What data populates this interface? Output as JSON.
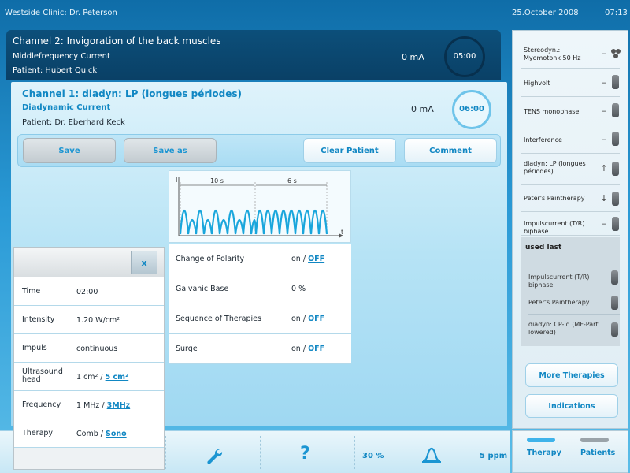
{
  "status_bar": {
    "clinic": "Westside Clinic: Dr. Peterson",
    "date": "25.October 2008",
    "time": "07:13"
  },
  "channel2": {
    "title": "Channel 2: Invigoration of the back muscles",
    "current_type": "Middlefrequency Current",
    "patient": "Patient: Hubert Quick",
    "intensity": "0 mA",
    "timer": "05:00"
  },
  "channel1": {
    "title": "Channel 1: diadyn: LP (longues périodes)",
    "current_type": "Diadynamic Current",
    "patient": "Patient: Dr. Eberhard Keck",
    "intensity": "0 mA",
    "timer": "06:00"
  },
  "buttons": {
    "save": "Save",
    "save_as": "Save as",
    "clear_patient": "Clear Patient",
    "comment": "Comment"
  },
  "waveform": {
    "axis_y": "I",
    "axis_x": "t",
    "segment1": "10 s",
    "segment2": "6 s"
  },
  "params": {
    "polarity": {
      "label": "Change of Polarity",
      "on": "on",
      "sep": " / ",
      "off": "OFF"
    },
    "galvanic": {
      "label": "Galvanic Base",
      "value": "0 %"
    },
    "sequence": {
      "label": "Sequence of Therapies",
      "on": "on",
      "sep": " / ",
      "off": "OFF"
    },
    "surge": {
      "label": "Surge",
      "on": "on",
      "sep": " / ",
      "off": "OFF"
    }
  },
  "popup": {
    "close": "x",
    "rows": {
      "time": {
        "label": "Time",
        "value": "02:00"
      },
      "intensity": {
        "label": "Intensity",
        "value": "1.20 W/cm²"
      },
      "impuls": {
        "label": "Impuls",
        "value": "continuous"
      },
      "head": {
        "label": "Ultrasound head",
        "opt1": "1 cm²",
        "sep": " / ",
        "opt2": "5 cm²"
      },
      "frequency": {
        "label": "Frequency",
        "opt1": "1 MHz",
        "sep": " / ",
        "opt2": "3MHz"
      },
      "therapy": {
        "label": "Therapy",
        "opt1": "Comb",
        "sep": " / ",
        "opt2": "Sono"
      }
    }
  },
  "bottom_bar": {
    "percent": "30 %",
    "ppm": "5 ppm",
    "help": "?"
  },
  "sidebar": {
    "items": [
      {
        "label": "Stereodyn.: Myomotonk 50 Hz",
        "control": "–"
      },
      {
        "label": "Highvolt",
        "control": "–"
      },
      {
        "label": "TENS monophase",
        "control": "–"
      },
      {
        "label": "Interference",
        "control": "–"
      },
      {
        "label": "diadyn: LP (longues périodes)",
        "control": "↑"
      },
      {
        "label": "Peter's Paintherapy",
        "control": "↓"
      },
      {
        "label": "Impulscurrent (T/R) biphase",
        "control": "–"
      }
    ],
    "used_last_title": "used last",
    "used_last": [
      "Impulscurrent (T/R) biphase",
      "Peter's Paintherapy",
      "diadyn: CP-id (MF-Part lowered)"
    ],
    "more": "More Therapies",
    "indications": "Indications"
  },
  "nav": {
    "therapy": "Therapy",
    "patients": "Patients"
  }
}
